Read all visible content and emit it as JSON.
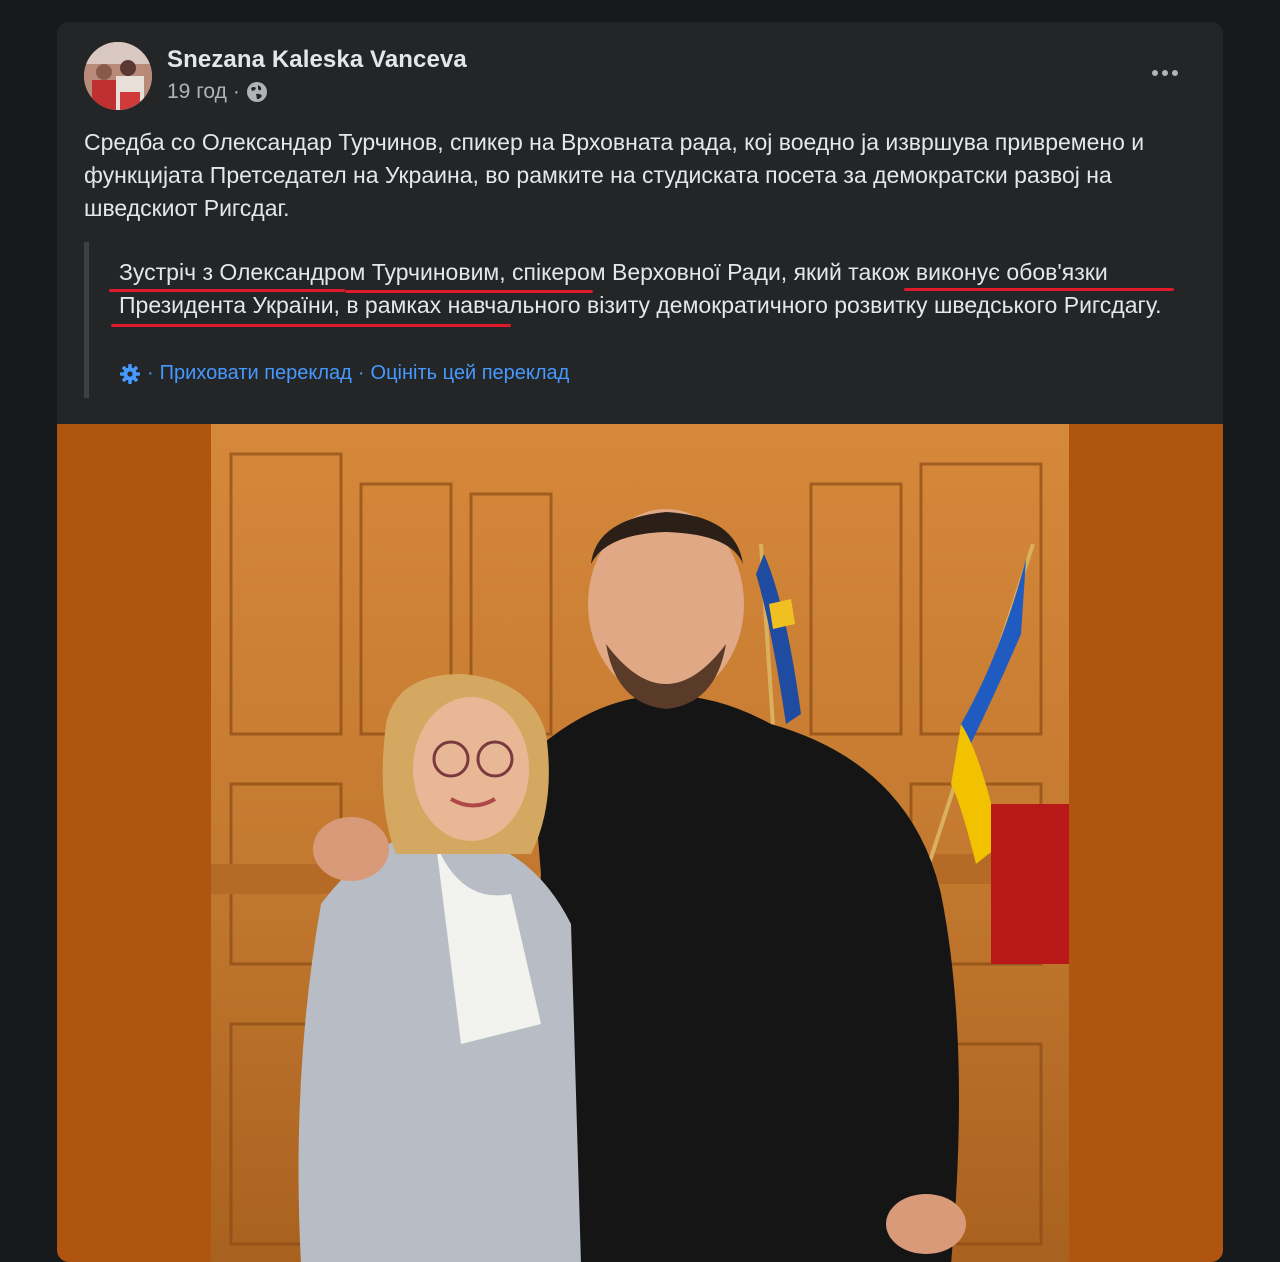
{
  "post": {
    "author": "Snezana Kaleska Vanceva",
    "time": "19 год",
    "separator": "·",
    "privacy_icon": "globe-icon",
    "more_icon": "more-dots-icon",
    "text": "Средба со Олександар Турчинов, спикер на Врховната рада, кој воедно ја извршува привремено и функцијата Претседател на Украина, во рамките на студиската посета за демократски развој на шведскиот Ригсдаг."
  },
  "translation": {
    "text": "Зустріч з Олександром Турчиновим, спікером Верховної Ради, який також виконує обов'язки Президента України, в рамках навчального візиту демократичного розвитку шведського Ригсдагу.",
    "settings_icon": "gear-icon",
    "sep1": "·",
    "hide_label": "Приховати переклад",
    "sep2": "·",
    "rate_label": "Оцініть цей переклад"
  },
  "colors": {
    "background": "#18191a",
    "card": "#242526",
    "link": "#4599ff",
    "underline": "#e0192b",
    "photo_bg": "#b05510"
  }
}
